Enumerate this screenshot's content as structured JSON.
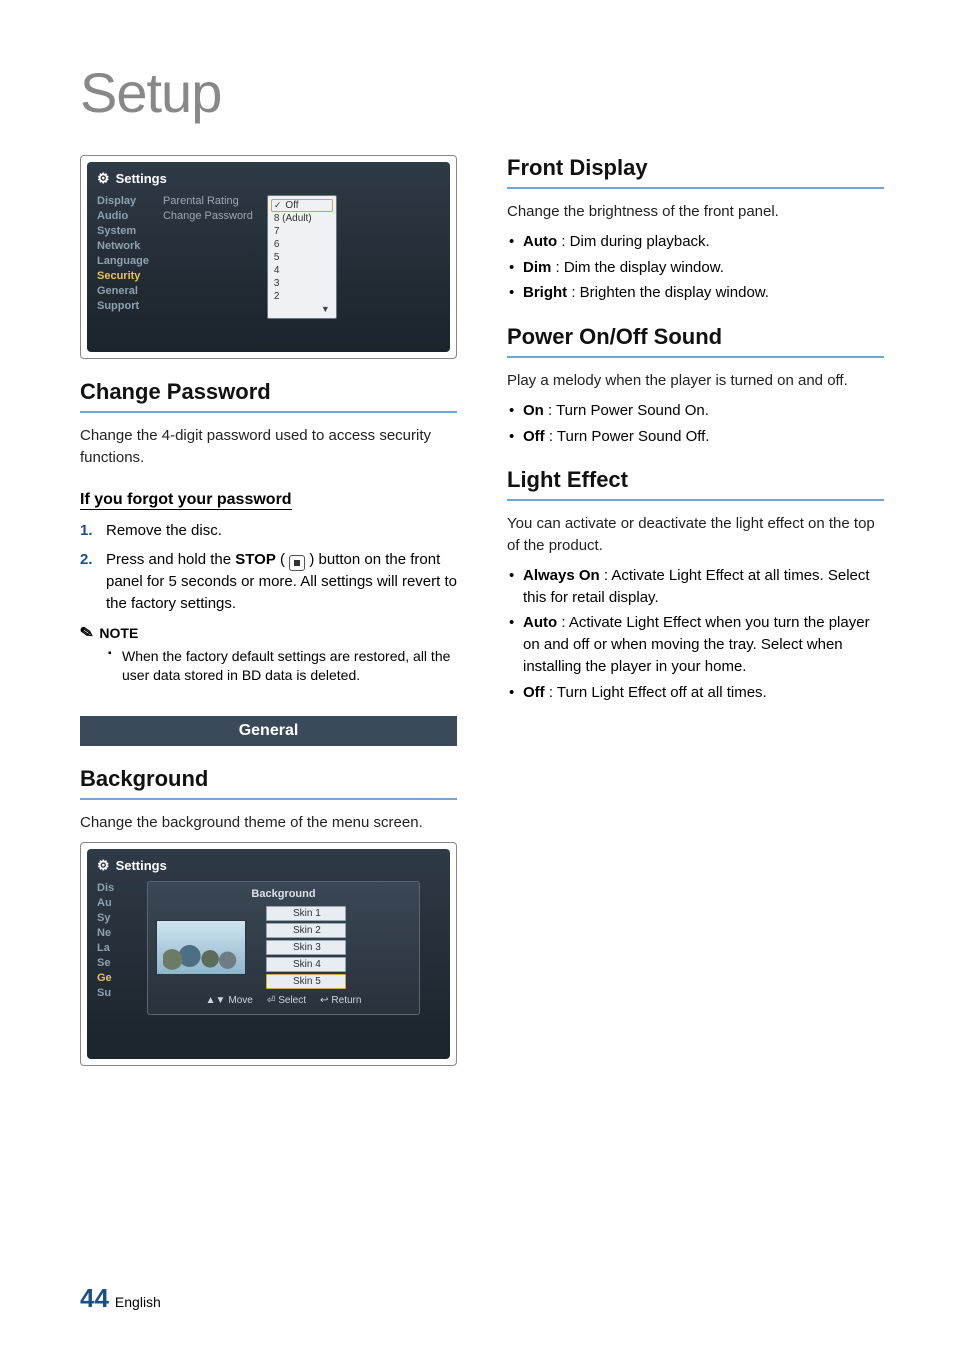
{
  "page": {
    "title": "Setup",
    "number": "44",
    "lang": "English"
  },
  "left": {
    "panel1": {
      "title": "Settings",
      "side": [
        "Display",
        "Audio",
        "System",
        "Network",
        "Language",
        "Security",
        "General",
        "Support"
      ],
      "side_selected": "Security",
      "mid": [
        "Parental Rating",
        "Change Password"
      ],
      "dropdown": [
        "Off",
        "8 (Adult)",
        "7",
        "6",
        "5",
        "4",
        "3",
        "2"
      ],
      "dropdown_checked": "Off"
    },
    "change_password": {
      "heading": "Change Password",
      "body": "Change the 4-digit password used to access security functions.",
      "sub": "If you forgot your password",
      "steps": [
        "Remove the disc.",
        "Press and hold the STOP button on the front panel for 5 seconds or more. All settings will revert to the factory settings."
      ],
      "step2_prefix": "Press and hold the ",
      "step2_bold": "STOP",
      "step2_mid": " ( ",
      "step2_after": " ) button on the front panel for 5 seconds or more.\nAll settings will revert to the factory settings.",
      "note_label": "NOTE",
      "note_body": "When the factory default settings are restored, all the user data stored in BD data is deleted."
    },
    "general_banner": "General",
    "background": {
      "heading": "Background",
      "body": "Change the background theme of the menu screen."
    },
    "panel2": {
      "title": "Settings",
      "side_trunc": [
        "Dis",
        "Au",
        "Sy",
        "Ne",
        "La",
        "Se",
        "Ge",
        "Su"
      ],
      "side_trunc_selected": "Ge",
      "modal_title": "Background",
      "skins": [
        "Skin 1",
        "Skin 2",
        "Skin 3",
        "Skin 4",
        "Skin 5"
      ],
      "skin_selected": "Skin 5",
      "footer": {
        "move": "Move",
        "select": "Select",
        "return": "Return"
      }
    }
  },
  "right": {
    "front_display": {
      "heading": "Front Display",
      "body": "Change the brightness of the front panel.",
      "items": [
        {
          "b": "Auto",
          "t": " : Dim during playback."
        },
        {
          "b": "Dim",
          "t": " : Dim the display window."
        },
        {
          "b": "Bright",
          "t": " : Brighten the display window."
        }
      ]
    },
    "power": {
      "heading": "Power On/Off Sound",
      "body": "Play a melody when the player is turned on and off.",
      "items": [
        {
          "b": "On",
          "t": " : Turn Power Sound On."
        },
        {
          "b": "Off",
          "t": " : Turn Power Sound Off."
        }
      ]
    },
    "light": {
      "heading": "Light Effect",
      "body": "You can activate or deactivate the light effect on the top of the product.",
      "items": [
        {
          "b": "Always On",
          "t": " : Activate Light Effect at all times. Select this for retail display."
        },
        {
          "b": "Auto",
          "t": " : Activate Light Effect when you turn the player on and off or when moving the tray. Select when installing the player in your home."
        },
        {
          "b": "Off",
          "t": " : Turn Light Effect off at all times."
        }
      ]
    }
  }
}
